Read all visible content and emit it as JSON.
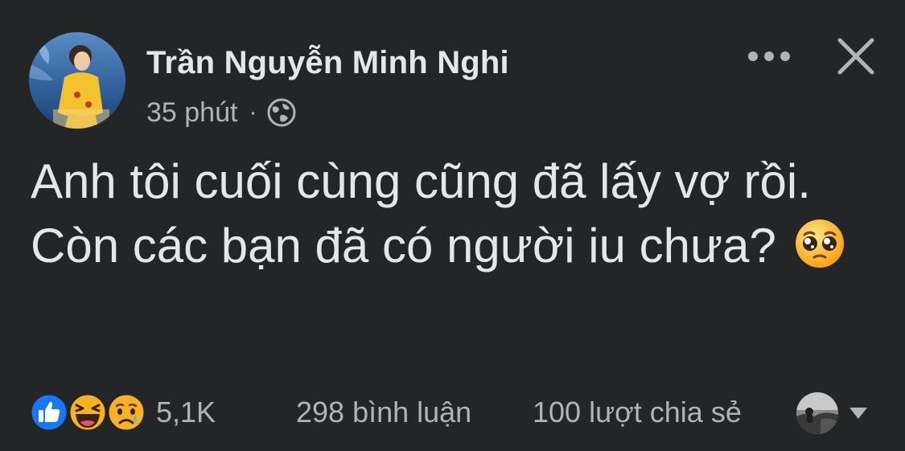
{
  "post": {
    "author": "Trần Nguyễn Minh Nghi",
    "time": "35 phút",
    "separator": "·",
    "privacy_icon": "globe-icon",
    "text": "Anh tôi cuối cùng cũng đã lấy vợ rồi. Còn các bạn đã có người iu chưa?",
    "text_emoji": "pleading-face-emoji"
  },
  "actions": {
    "more_icon": "more-horizontal-icon",
    "close_icon": "close-icon"
  },
  "footer": {
    "reaction_icons": [
      "like-reaction-icon",
      "haha-reaction-icon",
      "sad-reaction-icon"
    ],
    "reaction_count": "5,1K",
    "comments": "298 bình luận",
    "shares": "100 lượt chia sẻ",
    "viewer_dropdown_icon": "caret-down-icon"
  },
  "colors": {
    "background": "#242526",
    "primary_text": "#e4e6eb",
    "secondary_text": "#b0b3b8",
    "like_blue": "#1877f2",
    "emoji_yellow": "#fcd34d"
  }
}
